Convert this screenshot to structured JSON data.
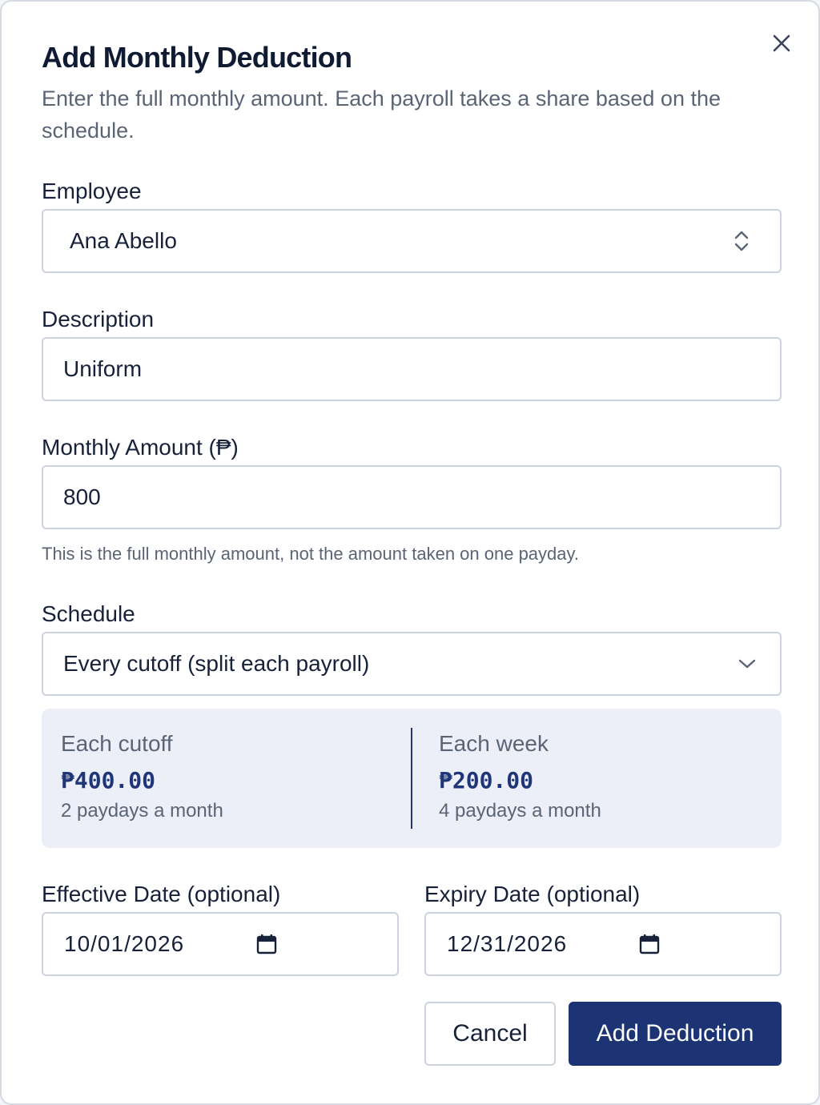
{
  "dialog": {
    "title": "Add Monthly Deduction",
    "subtitle": "Enter the full monthly amount. Each payroll takes a share based on the schedule.",
    "close_icon": "close-icon"
  },
  "employee": {
    "label": "Employee",
    "value": "Ana Abello",
    "icon": "chevron-up-down-icon"
  },
  "description": {
    "label": "Description",
    "value": "Uniform"
  },
  "monthly_amount": {
    "label": "Monthly Amount (₱)",
    "value": "800",
    "help": "This is the full monthly amount, not the amount taken on one payday."
  },
  "schedule": {
    "label": "Schedule",
    "value": "Every cutoff (split each payroll)",
    "icon": "chevron-down-icon"
  },
  "summary": {
    "cutoff": {
      "label": "Each cutoff",
      "amount": "₱400.00",
      "sub": "2 paydays a month"
    },
    "week": {
      "label": "Each week",
      "amount": "₱200.00",
      "sub": "4 paydays a month"
    }
  },
  "effective_date": {
    "label": "Effective Date (optional)",
    "value": "10/01/2026",
    "icon": "calendar-icon"
  },
  "expiry_date": {
    "label": "Expiry Date (optional)",
    "value": "12/31/2026",
    "icon": "calendar-icon"
  },
  "actions": {
    "cancel_label": "Cancel",
    "submit_label": "Add Deduction"
  },
  "colors": {
    "primary": "#1c3473",
    "summary_bg": "#eceff8",
    "text": "#18213a",
    "muted": "#5b6475",
    "border": "#cdd3de"
  }
}
